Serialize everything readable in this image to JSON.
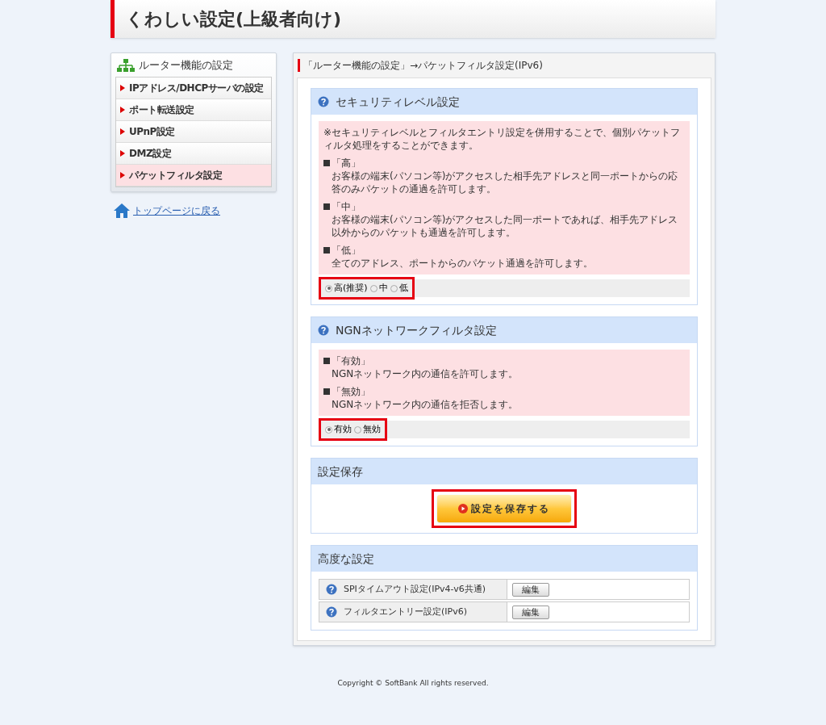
{
  "header": {
    "title": "くわしい設定(上級者向け)"
  },
  "sidebar": {
    "title": "ルーター機能の設定",
    "items": [
      {
        "label": "IPアドレス/DHCPサーバの設定",
        "selected": false
      },
      {
        "label": "ポート転送設定",
        "selected": false
      },
      {
        "label": "UPnP設定",
        "selected": false
      },
      {
        "label": "DMZ設定",
        "selected": false
      },
      {
        "label": "パケットフィルタ設定",
        "selected": true
      }
    ],
    "home_link": "トップページに戻る"
  },
  "main": {
    "title": "「ルーター機能の設定」→パケットフィルタ設定(IPv6)",
    "sections": [
      {
        "kind": "radio",
        "title": "セキュリティレベル設定",
        "note": "※セキュリティレベルとフィルタエントリ設定を併用することで、個別パケットフィルタ処理をすることができます。",
        "entries": [
          {
            "label": "「高」",
            "text": "お客様の端末(パソコン等)がアクセスした相手先アドレスと同一ポートからの応答のみパケットの通過を許可します。"
          },
          {
            "label": "「中」",
            "text": "お客様の端末(パソコン等)がアクセスした同一ポートであれば、相手先アドレス以外からのパケットも通過を許可します。"
          },
          {
            "label": "「低」",
            "text": "全てのアドレス、ポートからのパケット通過を許可します。"
          }
        ],
        "highlighted": true,
        "options": [
          {
            "label": "高(推奨)",
            "selected": true
          },
          {
            "label": "中",
            "selected": false
          },
          {
            "label": "低",
            "selected": false
          }
        ]
      },
      {
        "kind": "radio",
        "title": "NGNネットワークフィルタ設定",
        "entries": [
          {
            "label": "「有効」",
            "text": "NGNネットワーク内の通信を許可します。"
          },
          {
            "label": "「無効」",
            "text": "NGNネットワーク内の通信を拒否します。"
          }
        ],
        "highlighted": true,
        "options": [
          {
            "label": "有効",
            "selected": true
          },
          {
            "label": "無効",
            "selected": false
          }
        ]
      },
      {
        "kind": "save",
        "title": "設定保存",
        "button": "設定を保存する",
        "highlighted": true
      },
      {
        "kind": "links",
        "title": "高度な設定",
        "rows": [
          {
            "label": "SPIタイムアウト設定(IPv4-v6共通)",
            "button": "編集"
          },
          {
            "label": "フィルタエントリー設定(IPv6)",
            "button": "編集"
          }
        ]
      }
    ]
  },
  "footer": "Copyright © SoftBank All rights reserved."
}
